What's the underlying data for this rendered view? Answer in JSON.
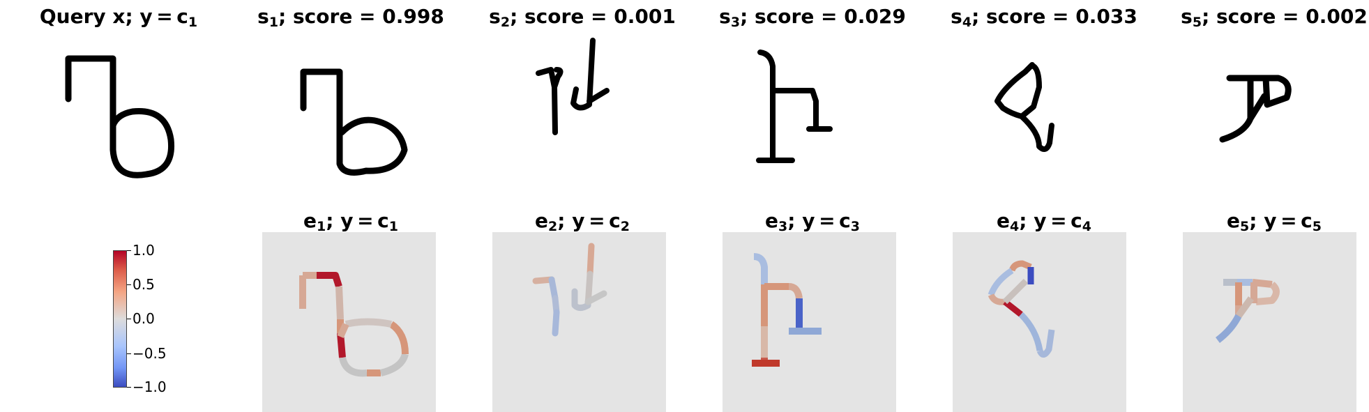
{
  "top_titles": [
    {
      "main": "Query x; y = c",
      "sub": "1",
      "tail": ""
    },
    {
      "main": "s",
      "sub": "1",
      "tail": "; score = 0.998"
    },
    {
      "main": "s",
      "sub": "2",
      "tail": "; score = 0.001"
    },
    {
      "main": "s",
      "sub": "3",
      "tail": "; score = 0.029"
    },
    {
      "main": "s",
      "sub": "4",
      "tail": "; score = 0.033"
    },
    {
      "main": "s",
      "sub": "5",
      "tail": "; score = 0.002"
    }
  ],
  "bottom_titles": [
    {
      "a": "e",
      "asub": "1",
      "b": "; y = c",
      "bsub": "1"
    },
    {
      "a": "e",
      "asub": "2",
      "b": "; y = c",
      "bsub": "2"
    },
    {
      "a": "e",
      "asub": "3",
      "b": "; y = c",
      "bsub": "3"
    },
    {
      "a": "e",
      "asub": "4",
      "b": "; y = c",
      "bsub": "4"
    },
    {
      "a": "e",
      "asub": "5",
      "b": "; y = c",
      "bsub": "5"
    }
  ],
  "colorbar": {
    "ticks": [
      "1.0",
      "0.5",
      "0.0",
      "−0.5",
      "−1.0"
    ],
    "colormap": "coolwarm",
    "range": [
      -1.0,
      1.0
    ]
  },
  "colors": {
    "red": "#b2182b",
    "salmon": "#d6967a",
    "grey": "#c4c4c4",
    "blue": "#8fa8d6",
    "darkblue": "#3b4cc0",
    "panel_bg": "#e4e4e4"
  }
}
